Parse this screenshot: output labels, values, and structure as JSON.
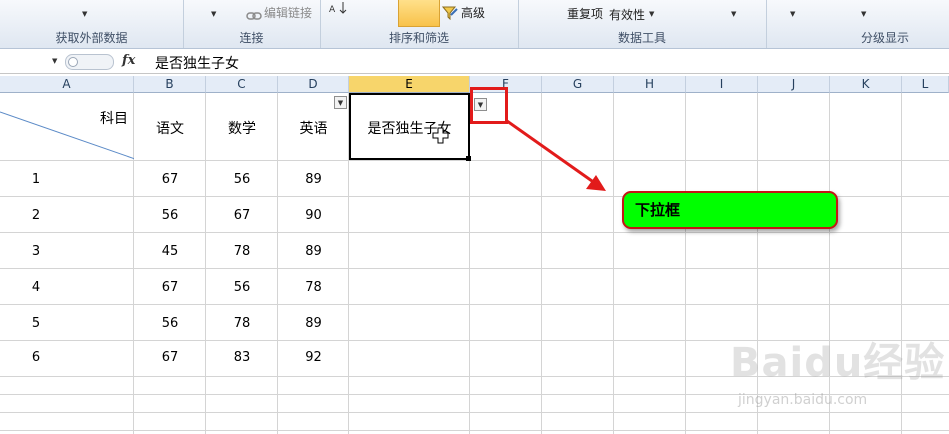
{
  "ribbon": {
    "groups": [
      {
        "label": "获取外部数据"
      },
      {
        "label": "连接"
      },
      {
        "label": "排序和筛选"
      },
      {
        "label": "数据工具"
      },
      {
        "label": "分级显示"
      }
    ],
    "edit_links": "编辑链接",
    "advanced": "高级",
    "duplicates": "重复项",
    "validity": "有效性"
  },
  "formula_bar": {
    "fx_label": "fx",
    "content": "是否独生子女"
  },
  "columns": [
    "A",
    "B",
    "C",
    "D",
    "E",
    "F",
    "G",
    "H",
    "I",
    "J",
    "K",
    "L"
  ],
  "selected_column": "E",
  "table": {
    "header_subject": "科目",
    "headers": [
      "语文",
      "数学",
      "英语",
      "是否独生子女"
    ],
    "rows": [
      {
        "id": "1",
        "vals": [
          "67",
          "56",
          "89"
        ]
      },
      {
        "id": "2",
        "vals": [
          "56",
          "67",
          "90"
        ]
      },
      {
        "id": "3",
        "vals": [
          "45",
          "78",
          "89"
        ]
      },
      {
        "id": "4",
        "vals": [
          "67",
          "56",
          "78"
        ]
      },
      {
        "id": "5",
        "vals": [
          "56",
          "78",
          "89"
        ]
      },
      {
        "id": "6",
        "vals": [
          "67",
          "83",
          "92"
        ]
      }
    ]
  },
  "callout": {
    "text": "下拉框",
    "fill": "#00ff00",
    "border": "#c41515"
  },
  "annotation_color": "#e21b1b",
  "watermark": {
    "brand": "Baidu经验",
    "url": "jingyan.baidu.com"
  }
}
